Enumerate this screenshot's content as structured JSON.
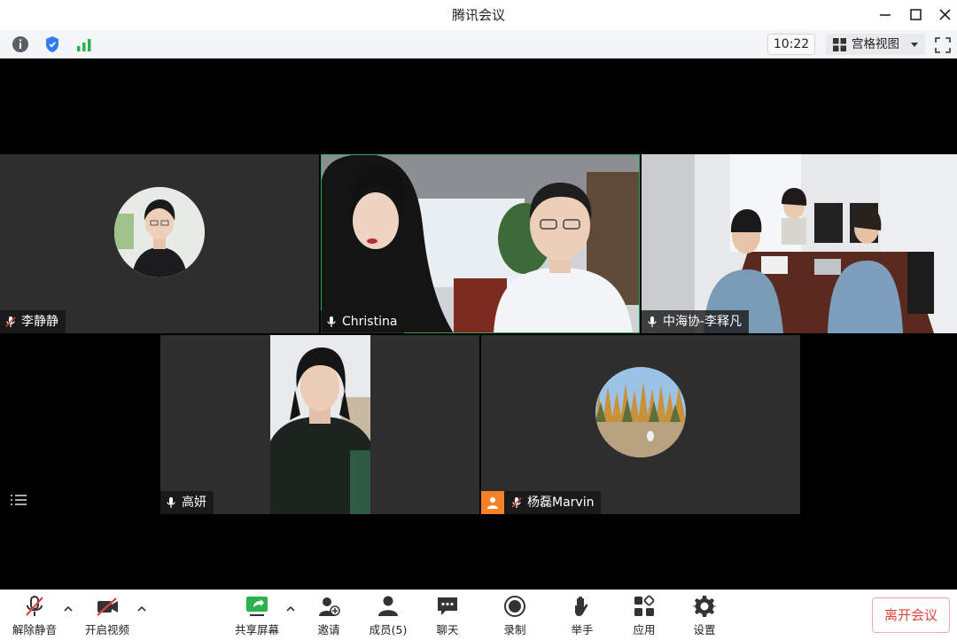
{
  "window": {
    "title": "腾讯会议"
  },
  "infobar": {
    "time": "10:22",
    "view_label": "宫格视图"
  },
  "participants": [
    {
      "name": "李静静",
      "mic": "muted"
    },
    {
      "name": "Christina",
      "mic": "on"
    },
    {
      "name": "中海协-李释凡",
      "mic": "on"
    },
    {
      "name": "高妍",
      "mic": "on"
    },
    {
      "name": "杨磊Marvin",
      "mic": "muted"
    }
  ],
  "toolbar": {
    "unmute": "解除静音",
    "start_video": "开启视频",
    "share_screen": "共享屏幕",
    "invite": "邀请",
    "members": "成员(5)",
    "chat": "聊天",
    "record": "录制",
    "raise_hand": "举手",
    "apps": "应用",
    "settings": "设置",
    "leave": "离开会议"
  },
  "colors": {
    "accent_green": "#3aa55d",
    "leave_red": "#e0443e",
    "tile_bg": "#2e2e2f",
    "avatar_orange": "#f5822a"
  }
}
